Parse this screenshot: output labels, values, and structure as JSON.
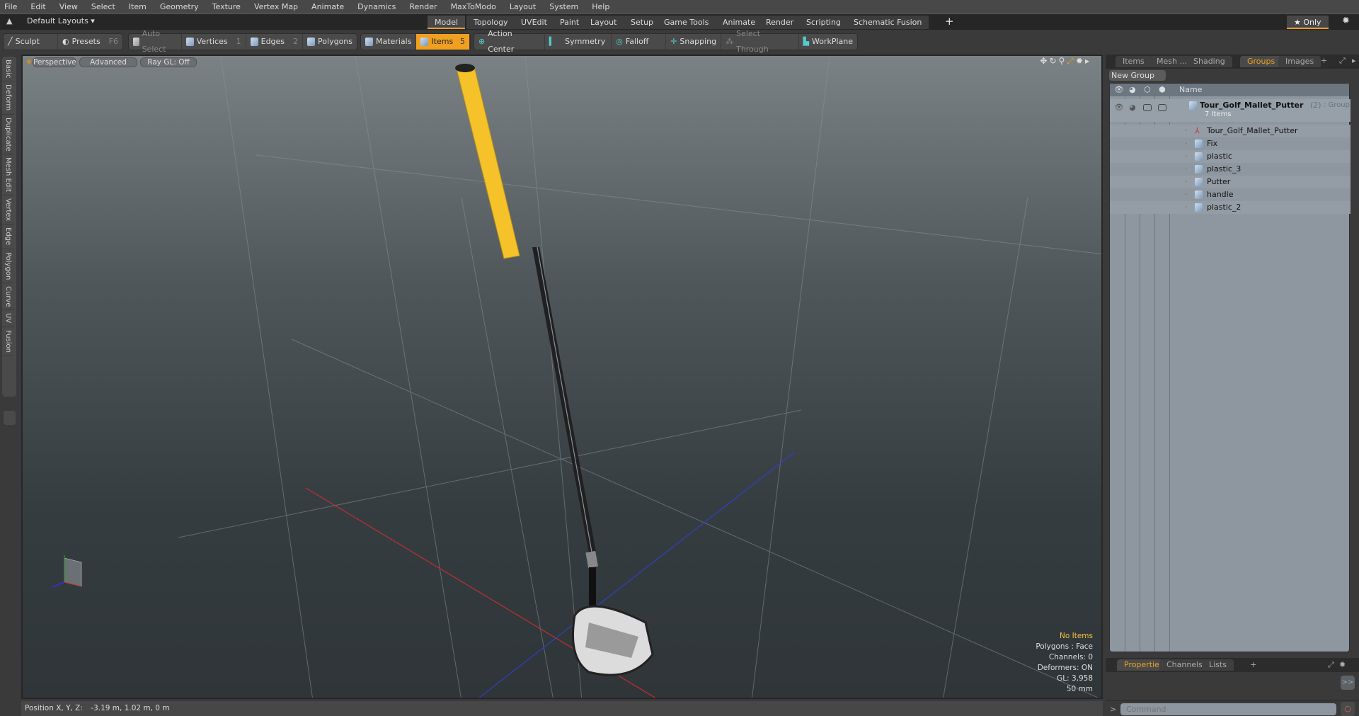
{
  "menu": [
    "File",
    "Edit",
    "View",
    "Select",
    "Item",
    "Geometry",
    "Texture",
    "Vertex Map",
    "Animate",
    "Dynamics",
    "Render",
    "MaxToModo",
    "Layout",
    "System",
    "Help"
  ],
  "layout_selector": "Default Layouts ▾",
  "layout_tabs": [
    {
      "label": "Model",
      "active": true
    },
    {
      "label": "Topology"
    },
    {
      "label": "UVEdit"
    },
    {
      "label": "Paint"
    },
    {
      "label": "Layout"
    },
    {
      "label": "Setup"
    },
    {
      "label": "Game Tools"
    },
    {
      "label": "Animate"
    },
    {
      "label": "Render"
    },
    {
      "label": "Scripting"
    },
    {
      "label": "Schematic Fusion"
    }
  ],
  "layout_add": "+",
  "only_label": "★ Only",
  "toolbar": {
    "sculpt": "Sculpt",
    "presets": "Presets",
    "presets_key": "F6",
    "auto_select": "Auto Select",
    "vertices": "Vertices",
    "vertices_num": "1",
    "edges": "Edges",
    "edges_num": "2",
    "polygons": "Polygons",
    "materials": "Materials",
    "items": "Items",
    "items_num": "5",
    "action_center": "Action Center",
    "symmetry": "Symmetry",
    "falloff": "Falloff",
    "snapping": "Snapping",
    "select_through": "Select Through",
    "workplane": "WorkPlane"
  },
  "left_tabs": [
    "Basic",
    "Deform",
    "Duplicate",
    "Mesh Edit",
    "Vertex",
    "Edge",
    "Polygon",
    "Curve",
    "UV",
    "Fusion"
  ],
  "viewport": {
    "perspective": "Perspective",
    "advanced": "Advanced",
    "raygl": "Ray GL: Off",
    "info": {
      "selection": "No Items",
      "polygons": "Polygons : Face",
      "channels": "Channels: 0",
      "deformers": "Deformers: ON",
      "gl": "GL: 3,958",
      "focal": "50 mm"
    },
    "colors": {
      "grip": "#f5c22a",
      "shaft": "#2a2c2e",
      "x_axis": "#c03030",
      "z_axis": "#3040c0"
    }
  },
  "right_panel": {
    "tabs": [
      {
        "label": "Items"
      },
      {
        "label": "Mesh ..."
      },
      {
        "label": "Shading"
      },
      {
        "label": "Groups",
        "active": true
      },
      {
        "label": "Images"
      }
    ],
    "new_group": "New Group",
    "name_header": "Name",
    "group": {
      "name": "Tour_Golf_Mallet_Putter",
      "count": "(2)",
      "type": ": Group",
      "sub": "7 Items"
    },
    "items": [
      {
        "name": "Tour_Golf_Mallet_Putter",
        "icon": "locator"
      },
      {
        "name": "Fix",
        "icon": "mesh"
      },
      {
        "name": "plastic",
        "icon": "mesh"
      },
      {
        "name": "plastic_3",
        "icon": "mesh"
      },
      {
        "name": "Putter",
        "icon": "mesh"
      },
      {
        "name": "handle",
        "icon": "mesh"
      },
      {
        "name": "plastic_2",
        "icon": "mesh"
      }
    ]
  },
  "bottom_panel": {
    "tabs": [
      {
        "label": "Properties",
        "active": true
      },
      {
        "label": "Channels"
      },
      {
        "label": "Lists"
      }
    ],
    "expand": ">>",
    "command_placeholder": "Command",
    "prompt": ">"
  },
  "status": {
    "position_label": "Position X, Y, Z:",
    "position_value": "-3.19 m, 1.02 m, 0 m"
  },
  "accent": "#f0a020"
}
